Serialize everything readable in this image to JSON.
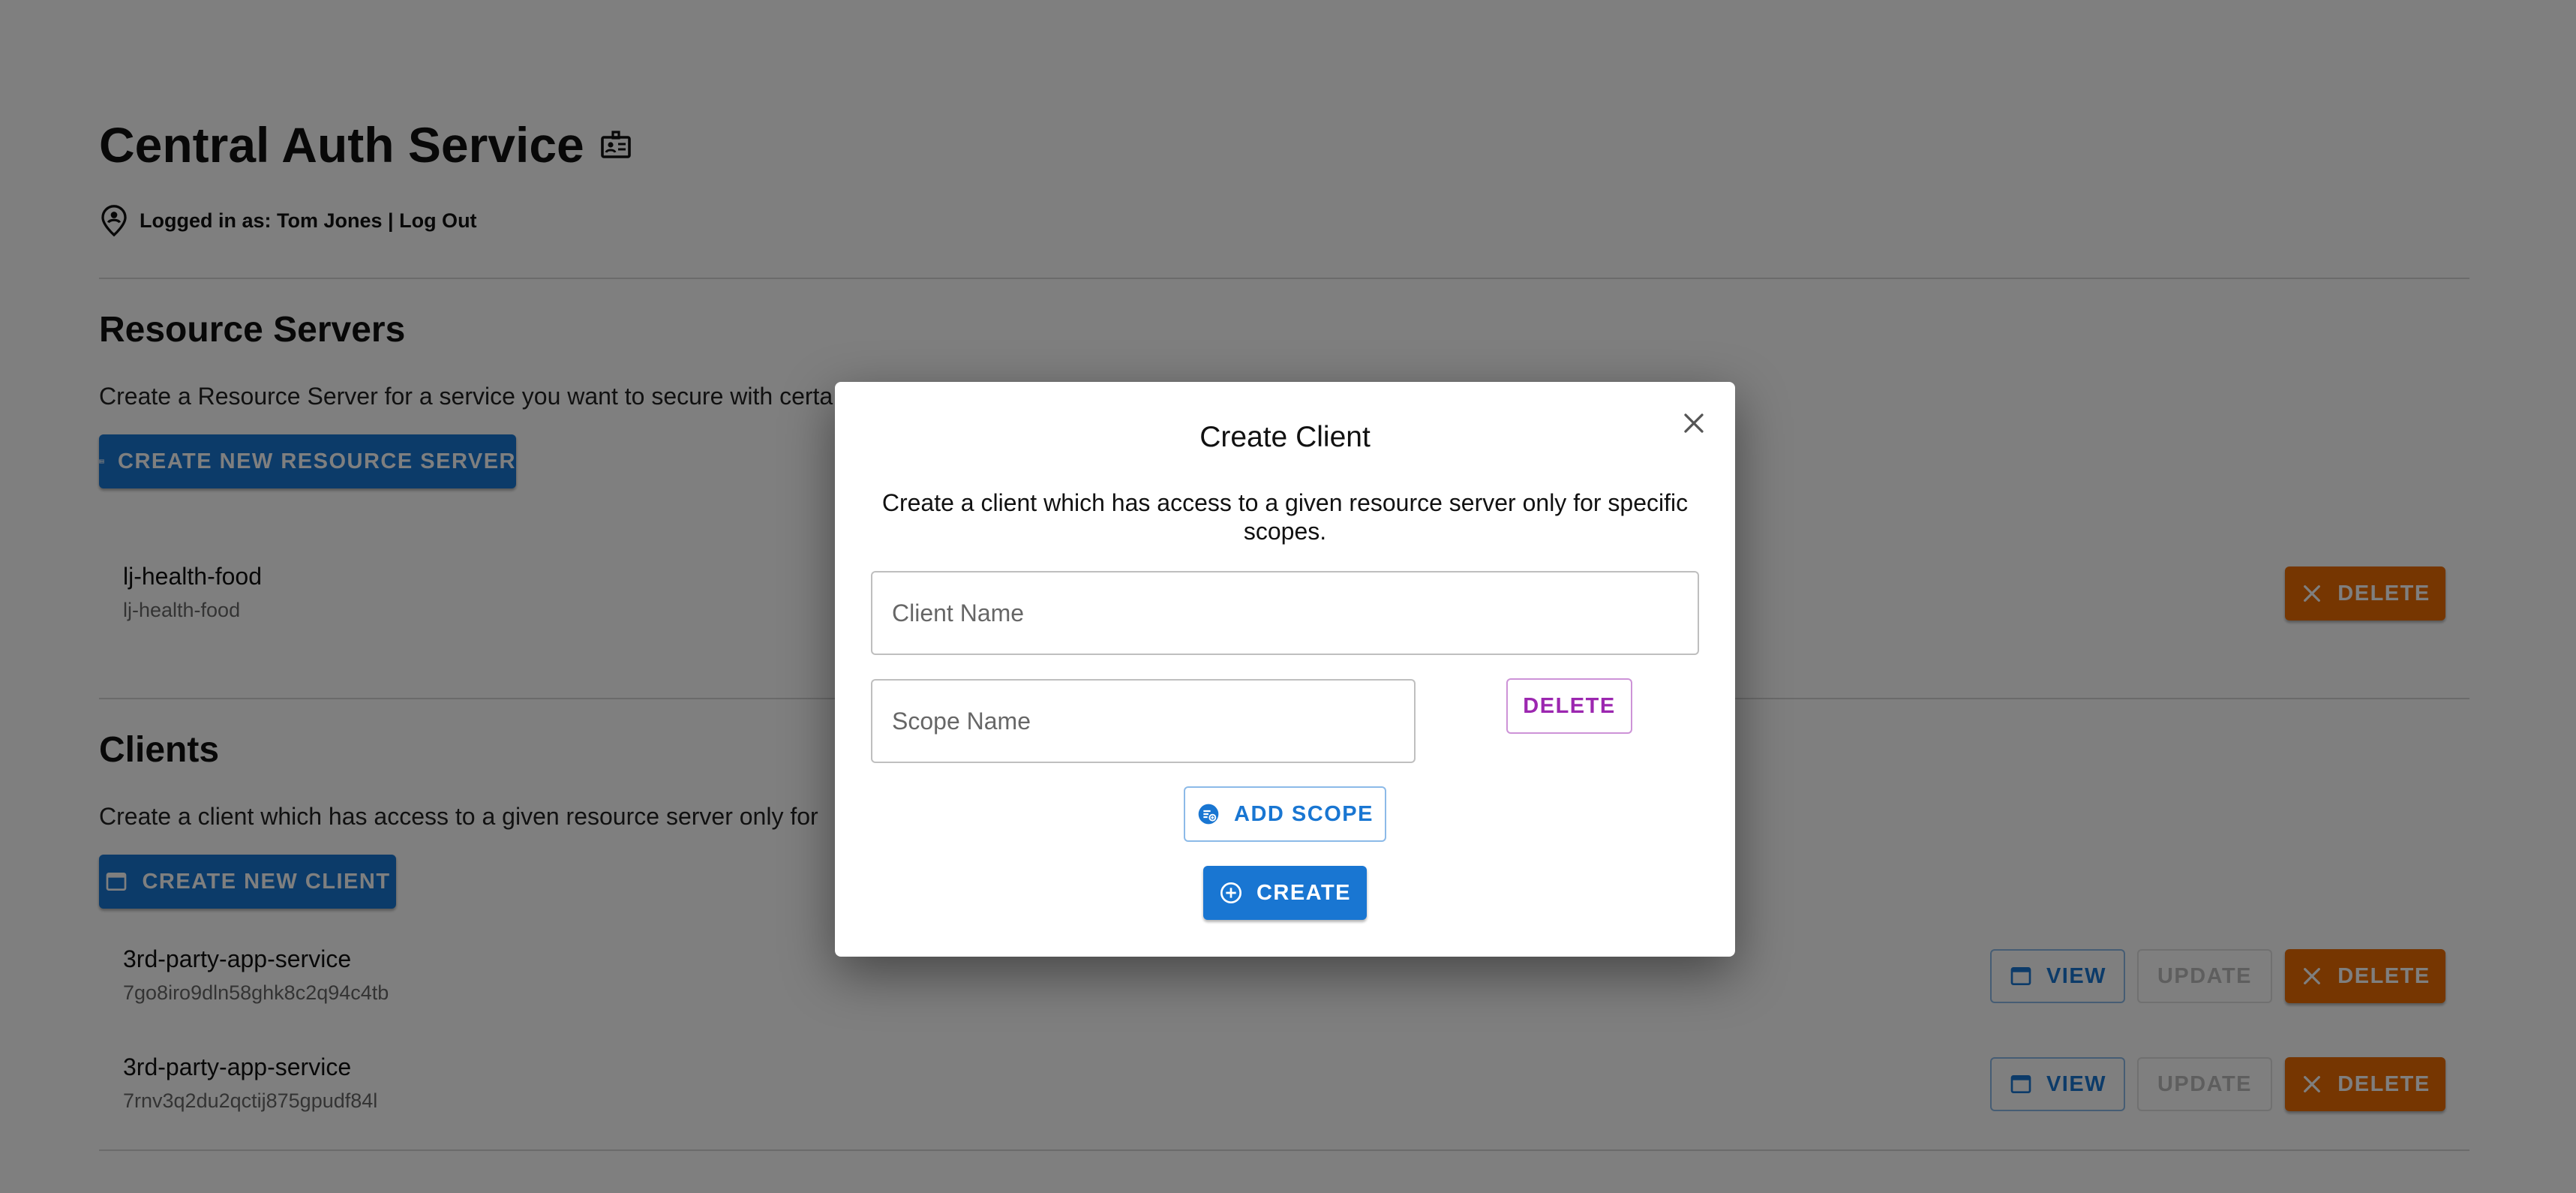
{
  "app": {
    "title": "Central Auth Service",
    "logged_in_text": "Logged in as: Tom Jones | Log Out"
  },
  "resource_servers": {
    "title": "Resource Servers",
    "description": "Create a Resource Server for a service you want to secure with certa",
    "create_button": "CREATE NEW RESOURCE SERVER",
    "items": [
      {
        "name": "lj-health-food",
        "id": "lj-health-food",
        "delete_label": "DELETE"
      }
    ]
  },
  "clients": {
    "title": "Clients",
    "description": "Create a client which has access to a given resource server only for",
    "create_button": "CREATE NEW CLIENT",
    "items": [
      {
        "name": "3rd-party-app-service",
        "id": "7go8iro9dln58ghk8c2q94c4tb",
        "view_label": "VIEW",
        "update_label": "UPDATE",
        "delete_label": "DELETE"
      },
      {
        "name": "3rd-party-app-service",
        "id": "7rnv3q2du2qctij875gpudf84l",
        "view_label": "VIEW",
        "update_label": "UPDATE",
        "delete_label": "DELETE"
      }
    ]
  },
  "dialog": {
    "title": "Create Client",
    "description": "Create a client which has access to a given resource server only for specific scopes.",
    "client_name_placeholder": "Client Name",
    "client_name_value": "",
    "scope_name_placeholder": "Scope Name",
    "scope_name_value": "",
    "delete_scope_label": "DELETE",
    "add_scope_label": "ADD SCOPE",
    "create_label": "CREATE"
  },
  "colors": {
    "primary": "#1976d2",
    "warning": "#ed6c02",
    "secondary": "#9c27b0",
    "backdrop": "rgba(0,0,0,0.5)"
  },
  "icons": {
    "title": "badge-icon",
    "login": "person-pin-icon",
    "create_resource_server": "storage-icon",
    "create_client": "web-asset-icon",
    "delete": "close-icon",
    "view": "web-asset-icon",
    "add_scope": "add-scope-icon",
    "create": "add-circle-icon",
    "dialog_close": "close-icon"
  }
}
